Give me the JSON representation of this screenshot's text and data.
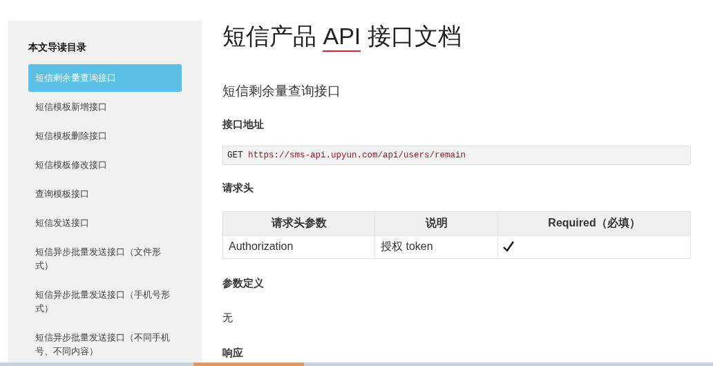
{
  "sidebar": {
    "title": "本文导读目录",
    "items": [
      {
        "label": "短信剩余量查询接口",
        "selected": true
      },
      {
        "label": "短信模板新增接口",
        "selected": false
      },
      {
        "label": "短信模板删除接口",
        "selected": false
      },
      {
        "label": "短信模板修改接口",
        "selected": false
      },
      {
        "label": "查询模板接口",
        "selected": false
      },
      {
        "label": "短信发送接口",
        "selected": false
      },
      {
        "label": "短信异步批量发送接口（文件形式）",
        "selected": false
      },
      {
        "label": "短信异步批量发送接口（手机号形式）",
        "selected": false
      },
      {
        "label": "短信异步批量发送接口（不同手机号、不同内容）",
        "selected": false
      }
    ]
  },
  "title": {
    "parts": [
      {
        "text": "短信产品 ",
        "spell_flagged": false
      },
      {
        "text": "API",
        "spell_flagged": true
      },
      {
        "text": " 接口文档",
        "spell_flagged": false
      }
    ]
  },
  "section_title": "短信剩余量查询接口",
  "endpoint": {
    "heading": "接口地址",
    "method": "GET",
    "url": "https://sms-api.upyun.com/api/users/remain"
  },
  "headers": {
    "heading": "请求头",
    "table": {
      "columns": [
        "请求头参数",
        "说明",
        "Required（必填）"
      ],
      "rows": [
        {
          "name": "Authorization",
          "description": "授权 token",
          "required": true
        }
      ]
    }
  },
  "params": {
    "heading": "参数定义",
    "text": "无"
  },
  "response": {
    "heading": "响应"
  }
}
